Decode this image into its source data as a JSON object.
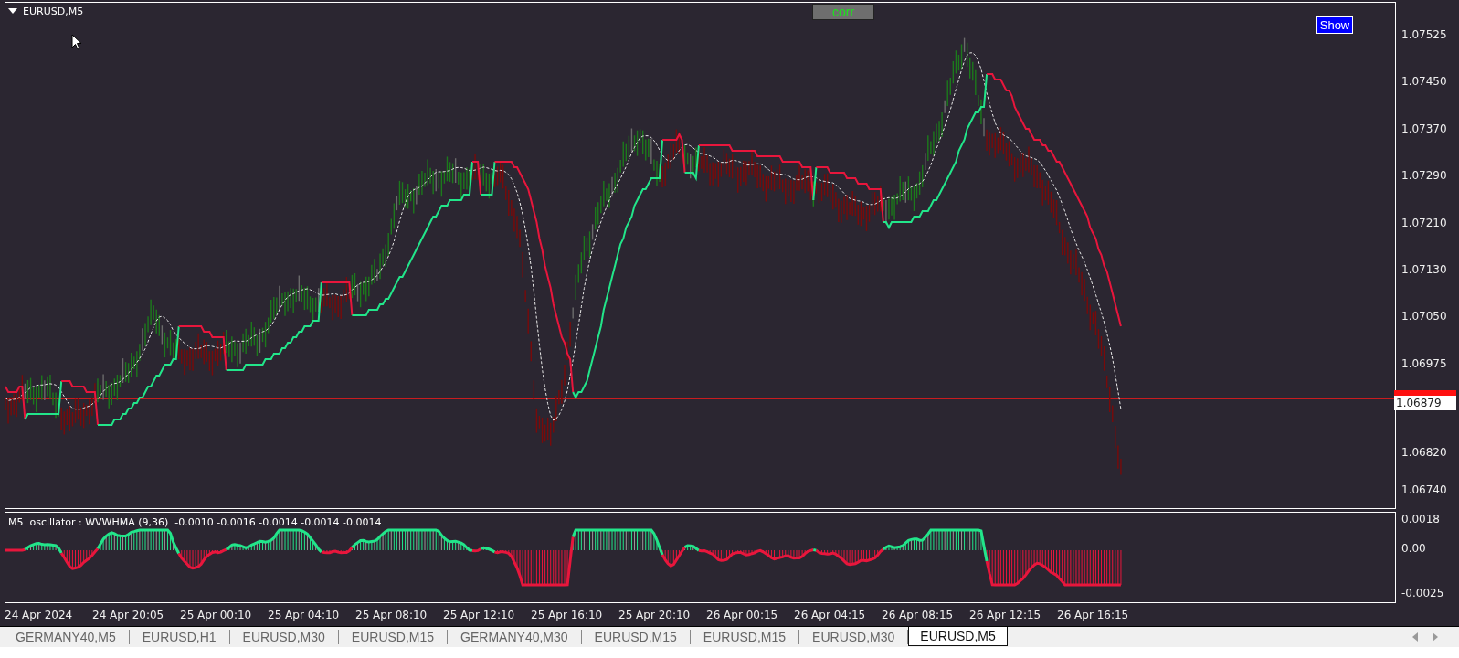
{
  "chart": {
    "symbol": "EURUSD,M5",
    "buttons": [
      {
        "label": "corr",
        "kind": "corr"
      },
      {
        "label": "Show",
        "kind": "show"
      }
    ],
    "price_ticks": [
      "1.07525",
      "1.07450",
      "1.07370",
      "1.07290",
      "1.07210",
      "1.07130",
      "1.07050",
      "1.06975"
    ],
    "price_ticks_low": [
      "1.06820",
      "1.06740"
    ],
    "current_price": "1.06879"
  },
  "oscillator": {
    "label": "M5  oscillator : WVWHMA (9,36)  -0.0010 -0.0016 -0.0014 -0.0014 -0.0014",
    "ticks": [
      "0.0018",
      "0.00",
      "-0.0025"
    ]
  },
  "time_axis": [
    "24 Apr 2024",
    "24 Apr 20:05",
    "25 Apr 00:10",
    "25 Apr 04:10",
    "25 Apr 08:10",
    "25 Apr 12:10",
    "25 Apr 16:10",
    "25 Apr 20:10",
    "26 Apr 00:15",
    "26 Apr 04:15",
    "26 Apr 08:15",
    "26 Apr 12:15",
    "26 Apr 16:15"
  ],
  "tabs": [
    {
      "label": "GERMANY40,M5",
      "selected": false
    },
    {
      "label": "EURUSD,H1",
      "selected": false
    },
    {
      "label": "EURUSD,M30",
      "selected": false
    },
    {
      "label": "EURUSD,M15",
      "selected": false
    },
    {
      "label": "GERMANY40,M30",
      "selected": false
    },
    {
      "label": "EURUSD,M15",
      "selected": false
    },
    {
      "label": "EURUSD,M15",
      "selected": false
    },
    {
      "label": "EURUSD,M30",
      "selected": false
    },
    {
      "label": "EURUSD,M5",
      "selected": true
    }
  ]
}
